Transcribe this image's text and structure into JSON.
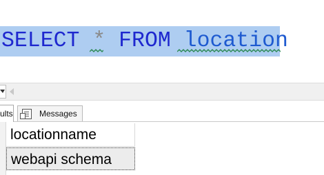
{
  "editor": {
    "query_keyword_select": "SELECT",
    "query_star": "*",
    "query_keyword_from": "FROM",
    "query_table": "location",
    "selection_color": "#aecdf1",
    "keyword_color": "#1e28cf",
    "squiggle_color": "#2e8b57"
  },
  "results_tabs": {
    "results_label": "ults",
    "messages_label": "Messages",
    "messages_icon": "messages-icon"
  },
  "results_grid": {
    "columns": [
      "locationname"
    ],
    "rows": [
      [
        "webapi schema"
      ]
    ]
  }
}
